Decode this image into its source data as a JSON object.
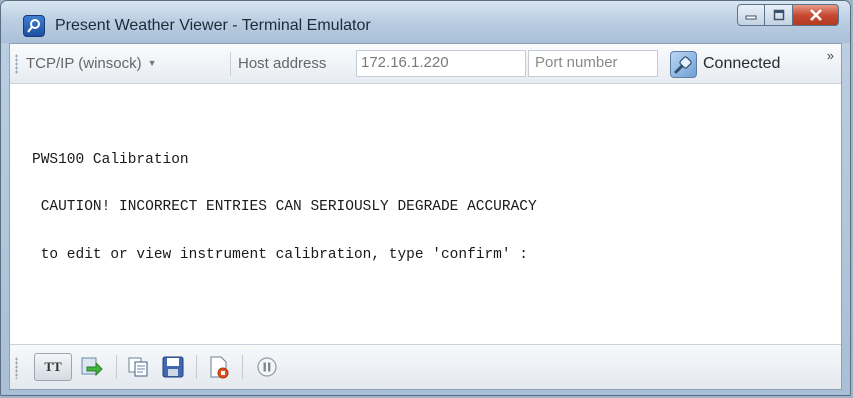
{
  "window": {
    "title": "Present Weather Viewer - Terminal Emulator"
  },
  "toolbar": {
    "protocol": "TCP/IP (winsock)",
    "host_label": "Host address",
    "host_value": "172.16.1.220",
    "port_placeholder": "Port number",
    "connect_label": "Connected",
    "overflow_label": "»"
  },
  "terminal": {
    "lines": [
      "PWS100 Calibration",
      " CAUTION! INCORRECT ENTRIES CAN SERIOUSLY DEGRADE ACCURACY",
      " to edit or view instrument calibration, type 'confirm' :"
    ]
  },
  "statusbar": {
    "tt_label": "TT"
  }
}
